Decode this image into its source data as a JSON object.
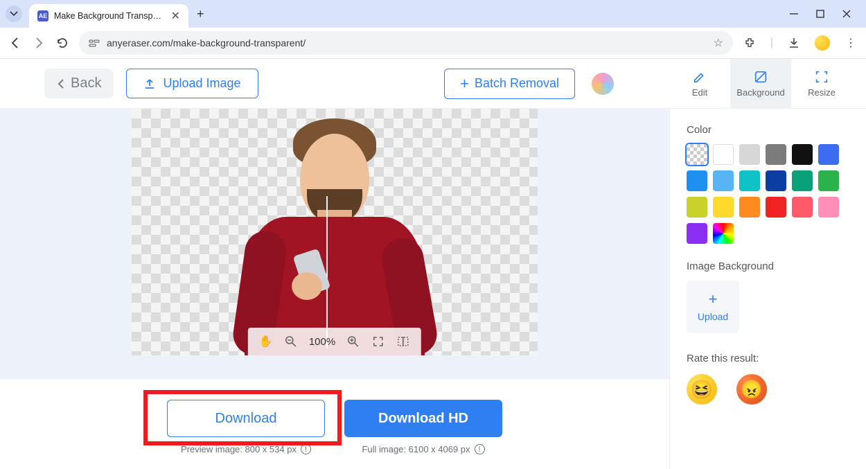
{
  "browser": {
    "tab_title": "Make Background Transparent",
    "url": "anyeraser.com/make-background-transparent/"
  },
  "header": {
    "back": "Back",
    "upload_image": "Upload Image",
    "batch_removal": "Batch Removal",
    "tools": {
      "edit": "Edit",
      "background": "Background",
      "resize": "Resize"
    }
  },
  "canvas": {
    "zoom": "100%"
  },
  "download": {
    "download": "Download",
    "download_hd": "Download HD",
    "preview_caption": "Preview image: 800 x 534 px",
    "full_caption": "Full image: 6100 x 4069 px"
  },
  "sidebar": {
    "color_label": "Color",
    "colors": [
      "transparent",
      "#ffffff",
      "#d7d7d7",
      "#7c7c7c",
      "#111111",
      "#3d6cf2",
      "#1e90ef",
      "#59b4f5",
      "#0ec2c8",
      "#0b3ea0",
      "#0aa07a",
      "#2cb24a",
      "#c9d22a",
      "#ffd92b",
      "#ff8a1f",
      "#f02424",
      "#ff5a6a",
      "#ff8fb7",
      "#8b2ff2",
      "rainbow"
    ],
    "image_bg_label": "Image Background",
    "upload": "Upload",
    "rate_label": "Rate this result:"
  }
}
